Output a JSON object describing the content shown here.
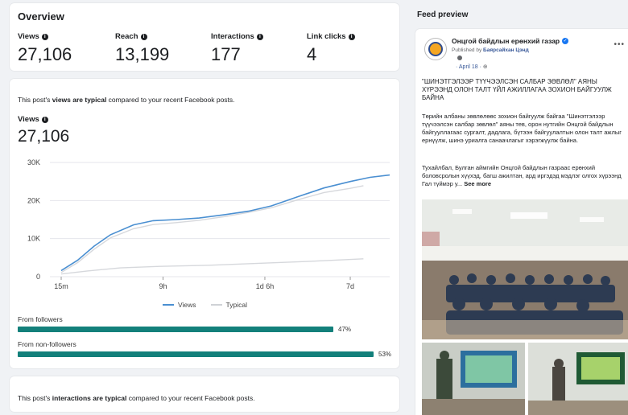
{
  "overview": {
    "title": "Overview",
    "metrics": [
      {
        "label": "Views",
        "value": "27,106"
      },
      {
        "label": "Reach",
        "value": "13,199"
      },
      {
        "label": "Interactions",
        "value": "177"
      },
      {
        "label": "Link clicks",
        "value": "4"
      }
    ]
  },
  "views_card": {
    "note_pre": "This post's ",
    "note_bold": "views are typical",
    "note_post": " compared to your recent Facebook posts.",
    "label": "Views",
    "value": "27,106"
  },
  "chart_data": {
    "type": "line",
    "x_ticks": [
      "15m",
      "9h",
      "1d 6h",
      "7d"
    ],
    "y_ticks": [
      "0",
      "10K",
      "20K",
      "30K"
    ],
    "ylim": [
      0,
      30000
    ],
    "series": [
      {
        "name": "Views",
        "color": "#4a8fd1",
        "points": [
          [
            0,
            1600
          ],
          [
            0.05,
            4300
          ],
          [
            0.1,
            8000
          ],
          [
            0.15,
            11000
          ],
          [
            0.22,
            13600
          ],
          [
            0.28,
            14700
          ],
          [
            0.35,
            15000
          ],
          [
            0.42,
            15400
          ],
          [
            0.5,
            16300
          ],
          [
            0.57,
            17200
          ],
          [
            0.64,
            18600
          ],
          [
            0.72,
            21000
          ],
          [
            0.8,
            23300
          ],
          [
            0.88,
            25000
          ],
          [
            0.94,
            26100
          ],
          [
            1.0,
            26700
          ]
        ]
      },
      {
        "name": "Typical",
        "color": "#d6d8dc",
        "points": [
          [
            0,
            1100
          ],
          [
            0.05,
            3700
          ],
          [
            0.1,
            7200
          ],
          [
            0.15,
            10200
          ],
          [
            0.22,
            12600
          ],
          [
            0.28,
            13700
          ],
          [
            0.35,
            14200
          ],
          [
            0.42,
            14800
          ],
          [
            0.5,
            15800
          ],
          [
            0.57,
            16900
          ],
          [
            0.64,
            18100
          ],
          [
            0.72,
            20200
          ],
          [
            0.8,
            22100
          ],
          [
            0.88,
            23200
          ],
          [
            0.92,
            23900
          ]
        ]
      },
      {
        "name": "",
        "color": "#d6d8dc",
        "points": [
          [
            0,
            700
          ],
          [
            0.08,
            1500
          ],
          [
            0.18,
            2300
          ],
          [
            0.3,
            2700
          ],
          [
            0.45,
            3000
          ],
          [
            0.6,
            3500
          ],
          [
            0.75,
            4000
          ],
          [
            0.92,
            4700
          ]
        ]
      }
    ]
  },
  "legend": {
    "views": "Views",
    "typical": "Typical"
  },
  "breakdown": [
    {
      "label": "From followers",
      "percent": 47,
      "pct_text": "47%"
    },
    {
      "label": "From non-followers",
      "percent": 53,
      "pct_text": "53%"
    }
  ],
  "interactions_card": {
    "note_pre": "This post's ",
    "note_bold": "interactions are typical",
    "note_post": " compared to your recent Facebook posts."
  },
  "feed_preview": {
    "title": "Feed preview",
    "page_name": "Онцгой байдлын ерөнхий газар",
    "published_by_pre": "Published by ",
    "published_by": "Баярсайхан Цэнд",
    "date": "April 18",
    "headline": "\"ШИНЭТГЭЛЭЭР ТҮҮЧЭЭЛСЭН САЛБАР ЗӨВЛӨЛ\" АЯНЫ ХҮРЭЭНД ОЛОН ТАЛТ ҮЙЛ АЖИЛЛАГАА ЗОХИОН БАЙГУУЛЖ БАЙНА",
    "para1": "Төрийн албаны зөвлөлөөс зохион байгуулж байгаа \"Шинэтгэлээр түүчээлсэн салбар зөвлөл\" аяны тев, орон нутгийн Онцгой байдлын байгууллагаас сургалт, дадлага, бүтээн байгуулалтын олон талт ажлыг ернүүлж, шинэ уриалга санаачлагыг хэрэгжүүлж байна.",
    "para2": "Тухайлбал, Булган аймгийн Онцгой байдлын газраас ерөнхий боловсролын хүүхэд, багш ажилтан, ард иргэдэд мэдлэг олгох хүрээнд Гал түймэр у...",
    "see_more": "See more"
  }
}
